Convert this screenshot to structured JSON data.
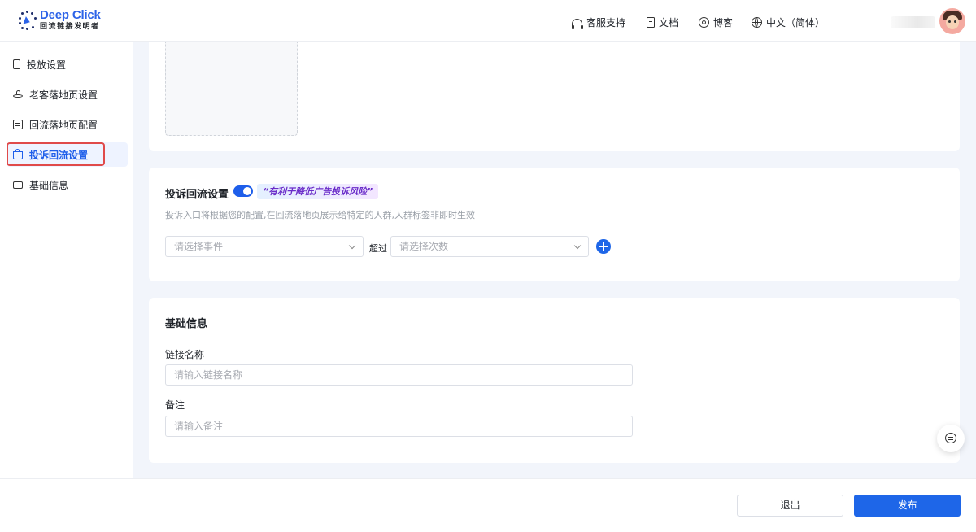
{
  "brand": {
    "name": "Deep Click",
    "tagline": "回流链接发明者"
  },
  "header": {
    "nav": [
      {
        "label": "客服支持",
        "icon": "headset-icon"
      },
      {
        "label": "文档",
        "icon": "document-icon"
      },
      {
        "label": "博客",
        "icon": "blog-icon"
      },
      {
        "label": "中文（简体）",
        "icon": "globe-icon"
      }
    ]
  },
  "sidebar": {
    "items": [
      {
        "label": "投放设置",
        "icon": "phone-icon"
      },
      {
        "label": "老客落地页设置",
        "icon": "ufo-icon"
      },
      {
        "label": "回流落地页配置",
        "icon": "note-icon"
      },
      {
        "label": "投诉回流设置",
        "icon": "bag-icon",
        "active": true
      },
      {
        "label": "基础信息",
        "icon": "card-icon"
      }
    ]
  },
  "complaint": {
    "title": "投诉回流设置",
    "toggle_on": true,
    "tagline": "“有利于降低广告投诉风险”",
    "description": "投诉入口将根据您的配置,在回流落地页展示给特定的人群,人群标签非即时生效",
    "event_placeholder": "请选择事件",
    "exceed_label": "超过",
    "count_placeholder": "请选择次数"
  },
  "basic": {
    "title": "基础信息",
    "link_name_label": "链接名称",
    "link_name_placeholder": "请输入链接名称",
    "remark_label": "备注",
    "remark_placeholder": "请输入备注"
  },
  "footer": {
    "exit_label": "退出",
    "publish_label": "发布"
  },
  "colors": {
    "accent": "#1e66e8",
    "highlight_outline": "#e04a4a",
    "page_bg": "#f2f5fb"
  }
}
